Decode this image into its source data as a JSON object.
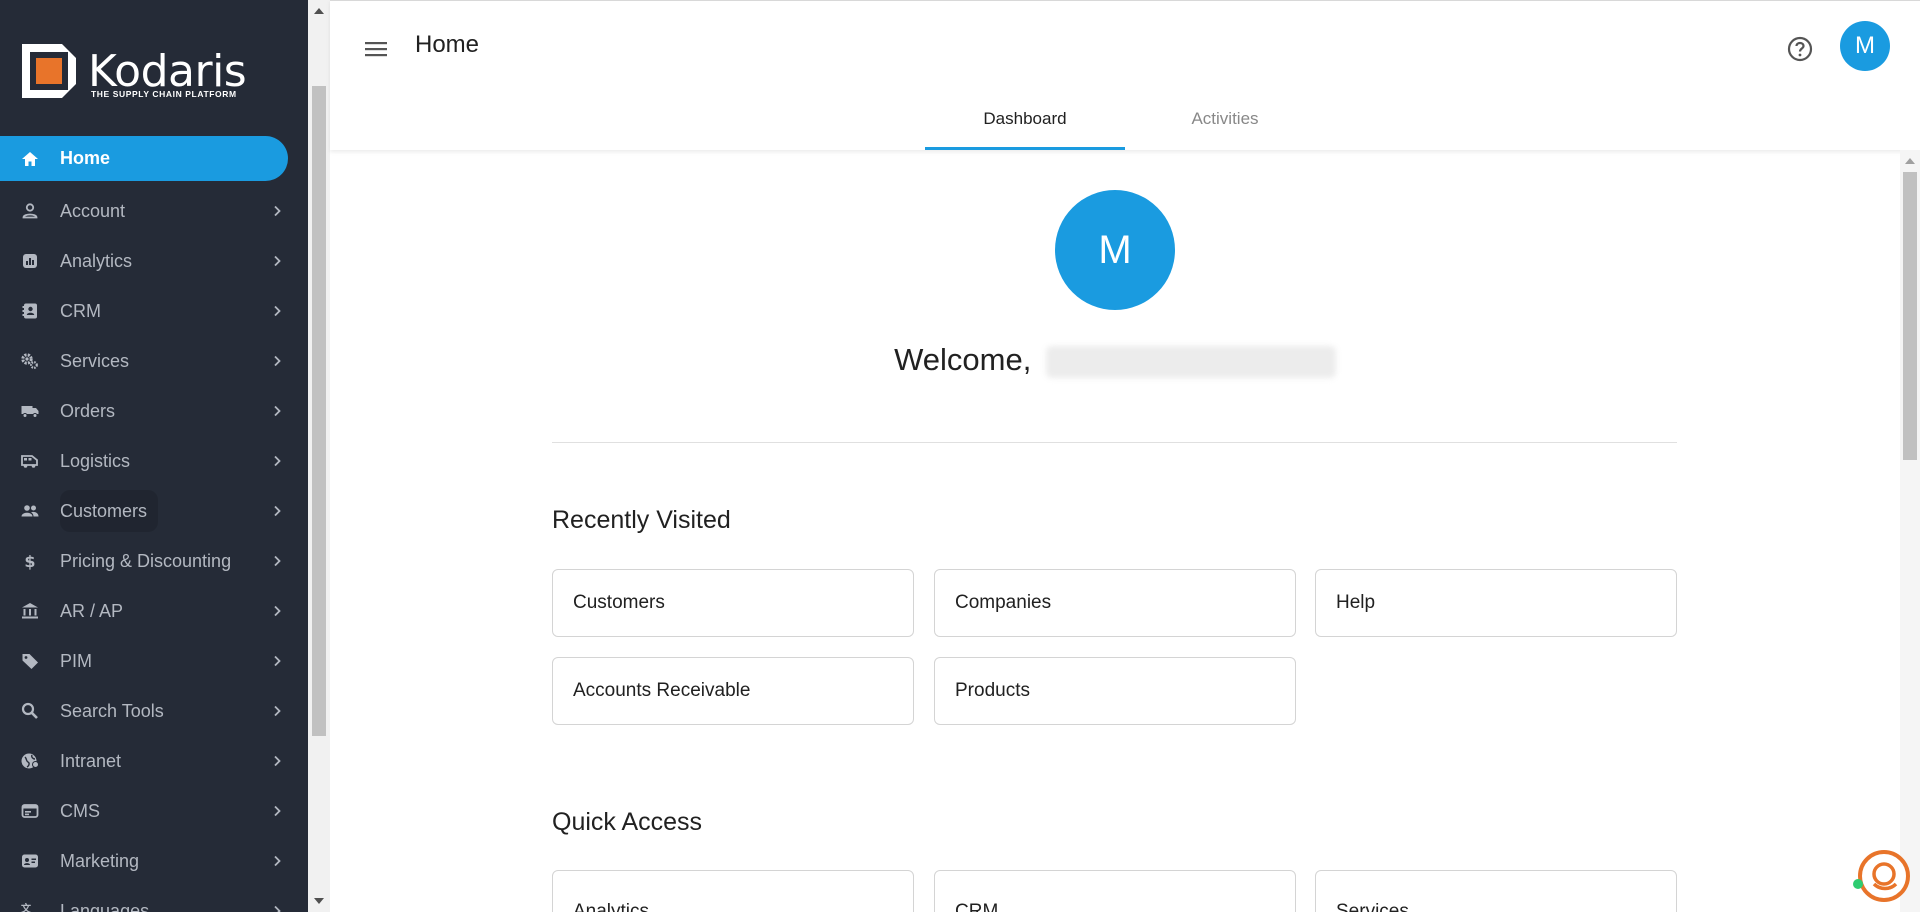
{
  "brand": {
    "name": "Kodaris",
    "tagline": "THE SUPPLY CHAIN PLATFORM",
    "accent": "#1a9be0",
    "logo_orange": "#e8742a"
  },
  "sidebar": {
    "items": [
      {
        "label": "Home",
        "icon": "home-icon",
        "active": true
      },
      {
        "label": "Account",
        "icon": "person-icon"
      },
      {
        "label": "Analytics",
        "icon": "analytics-icon"
      },
      {
        "label": "CRM",
        "icon": "contact-card-icon"
      },
      {
        "label": "Services",
        "icon": "gears-icon"
      },
      {
        "label": "Orders",
        "icon": "truck-icon"
      },
      {
        "label": "Logistics",
        "icon": "bus-icon"
      },
      {
        "label": "Customers",
        "icon": "group-icon"
      },
      {
        "label": "Pricing & Discounting",
        "icon": "dollar-icon"
      },
      {
        "label": "AR / AP",
        "icon": "bank-icon"
      },
      {
        "label": "PIM",
        "icon": "tag-icon"
      },
      {
        "label": "Search Tools",
        "icon": "search-icon"
      },
      {
        "label": "Intranet",
        "icon": "globe-icon"
      },
      {
        "label": "CMS",
        "icon": "cms-icon"
      },
      {
        "label": "Marketing",
        "icon": "marketing-icon"
      },
      {
        "label": "Languages",
        "icon": "translate-icon"
      }
    ]
  },
  "header": {
    "title": "Home",
    "avatar_initial": "M",
    "tabs": [
      {
        "label": "Dashboard",
        "active": true
      },
      {
        "label": "Activities",
        "active": false
      }
    ]
  },
  "main": {
    "avatar_initial": "M",
    "welcome_prefix": "Welcome,",
    "recently_visited": {
      "title": "Recently Visited",
      "items": [
        "Customers",
        "Companies",
        "Help",
        "Accounts Receivable",
        "Products"
      ]
    },
    "quick_access": {
      "title": "Quick Access",
      "items": [
        "Analytics",
        "CRM",
        "Services"
      ]
    }
  }
}
